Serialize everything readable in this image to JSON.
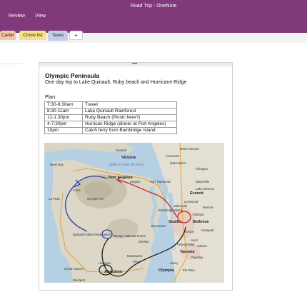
{
  "app": {
    "window_title": "Road Trip - OneNote",
    "menu": [
      "Review",
      "View"
    ]
  },
  "section_tabs": [
    {
      "label": "Carter",
      "color": "#f4c5a8"
    },
    {
      "label": "Chore list",
      "color": "#f6e08a"
    },
    {
      "label": "Taxes",
      "color": "#c6cde8",
      "active": true
    },
    {
      "label": "+",
      "color": "#ffffff"
    }
  ],
  "note": {
    "title": "Olympic Peninsula",
    "subtitle": "One day trip to Lake Quinault, Ruby beach and Hurricane Ridge",
    "plan_label": "Plan:",
    "handle": "• • • •",
    "plan_rows": [
      {
        "time": "7:30-8:30am",
        "activity": "Travel"
      },
      {
        "time": "8:30-11am",
        "activity": "Lake Quinault Rainforest"
      },
      {
        "time": "12-1:30pm",
        "activity": "Ruby Beach (Picnic here?)"
      },
      {
        "time": "4-7:30pm",
        "activity": "Hurrican Ridge (dinner at Port Angeles)"
      },
      {
        "time": "10pm",
        "activity": "Catch ferry from Bainbridge Island"
      }
    ]
  },
  "map": {
    "labels": {
      "strait": "Strait of Juan de Fuca",
      "seattle": "Seattle",
      "bellevue": "Bellevue",
      "olympia": "Olympia",
      "tacoma": "Tacoma",
      "aberdeen": "Aberdeen",
      "forks": "Forks",
      "olympic_np": "Olympic N.P.",
      "olympic_nf": "Olympic National Forest",
      "quinault": "Quinault Indian Reservation",
      "ocean_shores": "Ocean Shores",
      "everett": "Everett",
      "kirkland": "Kirkland",
      "port_angeles": "Port Angeles",
      "port_townsend": "Port Townsend",
      "bremerton": "Bremerton",
      "shelton": "Shelton",
      "oak_harbor": "Oak Harbor",
      "arlington": "Arlington",
      "marysville": "Marysville",
      "lake_stevens": "Lake Stevens",
      "monroe": "Monroe",
      "renton": "Renton",
      "kent": "Kent",
      "auburn": "Auburn",
      "puyallup": "Puyallup",
      "lacey": "Lacey",
      "elk_plain": "Elk Plain",
      "federal_way": "Federal Way",
      "sequim": "Sequim",
      "anacortes": "Anacortes",
      "mount_vernon": "Mount Vernon",
      "saanich": "Saanich",
      "victoria": "Victoria",
      "la_push": "La Push",
      "neah_bay": "Neah Bay",
      "montesano": "Montesano",
      "elma": "Elma",
      "hoquiam": "Hoquiam",
      "westport": "Westport",
      "issaquah": "Issaquah",
      "lynnwood": "Lynnwood",
      "edmonds": "Edmonds",
      "bainbridge": "Bainbridge Island"
    }
  }
}
